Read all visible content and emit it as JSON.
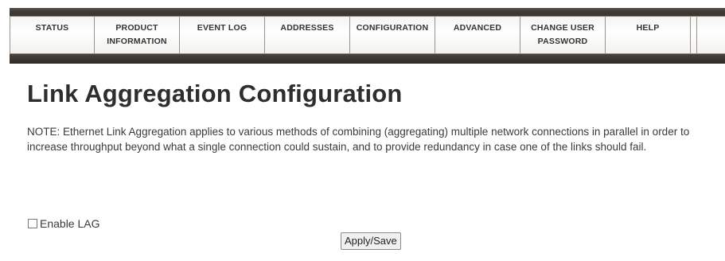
{
  "nav": {
    "items": [
      {
        "line1": "STATUS",
        "line2": ""
      },
      {
        "line1": "PRODUCT",
        "line2": "INFORMATION"
      },
      {
        "line1": "EVENT LOG",
        "line2": ""
      },
      {
        "line1": "ADDRESSES",
        "line2": ""
      },
      {
        "line1": "CONFIGURATION",
        "line2": ""
      },
      {
        "line1": "ADVANCED",
        "line2": ""
      },
      {
        "line1": "CHANGE USER",
        "line2": "PASSWORD"
      },
      {
        "line1": "HELP",
        "line2": ""
      }
    ]
  },
  "page": {
    "title": "Link Aggregation Configuration",
    "note": "NOTE: Ethernet Link Aggregation applies to various methods of combining (aggregating) multiple network connections in parallel in order to increase throughput beyond what a single connection could sustain, and to provide redundancy in case one of the links should fail."
  },
  "form": {
    "enable_lag_label": "Enable LAG",
    "enable_lag_checked": false,
    "apply_label": "Apply/Save"
  }
}
